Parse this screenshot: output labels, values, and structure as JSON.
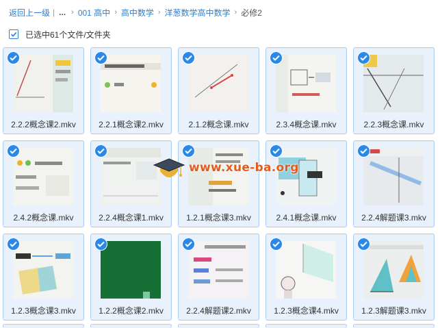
{
  "breadcrumb": {
    "back_label": "返回上一级",
    "ellipsis": "...",
    "items": [
      "001 高中",
      "高中数学",
      "洋葱数学高中数学"
    ],
    "current": "必修2"
  },
  "selection": {
    "label": "已选中61个文件/文件夹",
    "checked": true
  },
  "files": [
    {
      "name": "2.2.2概念课2.mkv",
      "checked": true
    },
    {
      "name": "2.2.1概念课2.mkv",
      "checked": true
    },
    {
      "name": "2.1.2概念课.mkv",
      "checked": true
    },
    {
      "name": "2.3.4概念课.mkv",
      "checked": true
    },
    {
      "name": "2.2.3概念课.mkv",
      "checked": true
    },
    {
      "name": "2.4.2概念课.mkv",
      "checked": true
    },
    {
      "name": "2.2.4概念课1.mkv",
      "checked": true
    },
    {
      "name": "1.2.1概念课3.mkv",
      "checked": true
    },
    {
      "name": "2.4.1概念课.mkv",
      "checked": true
    },
    {
      "name": "2.2.4解题课3.mkv",
      "checked": true
    },
    {
      "name": "1.2.3概念课3.mkv",
      "checked": true
    },
    {
      "name": "1.2.2概念课2.mkv",
      "checked": true
    },
    {
      "name": "2.2.4解题课2.mkv",
      "checked": true
    },
    {
      "name": "1.2.3概念课4.mkv",
      "checked": true
    },
    {
      "name": "1.2.3解题课3.mkv",
      "checked": true
    }
  ],
  "watermark": {
    "text": "www.xue-ba.org",
    "icon": "graduation-cap-icon"
  },
  "colors": {
    "accent": "#2c88e6",
    "link": "#2c7fd6",
    "card_bg": "#e9f2fc",
    "card_border": "#a8cdf3",
    "watermark": "#e45c1c"
  }
}
